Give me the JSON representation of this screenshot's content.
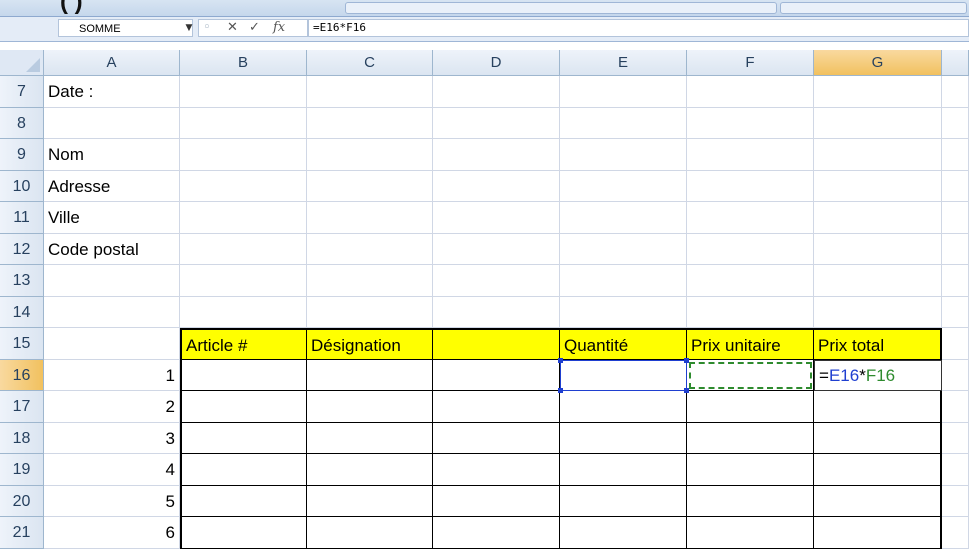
{
  "ribbon": {
    "cut_text": "(              )"
  },
  "formula_bar": {
    "name_box": "SOMME",
    "formula": "=E16*F16",
    "icons": [
      "dropdown-arrow-icon",
      "cancel-x-icon",
      "enter-check-icon",
      "function-fx-icon"
    ]
  },
  "columns": [
    "A",
    "B",
    "C",
    "D",
    "E",
    "F",
    "G"
  ],
  "selected_column": "G",
  "rows": [
    {
      "num": "7",
      "A": "Date :"
    },
    {
      "num": "8",
      "A": ""
    },
    {
      "num": "9",
      "A": "Nom"
    },
    {
      "num": "10",
      "A": "Adresse"
    },
    {
      "num": "11",
      "A": "Ville"
    },
    {
      "num": "12",
      "A": "Code postal"
    },
    {
      "num": "13",
      "A": ""
    },
    {
      "num": "14",
      "A": ""
    },
    {
      "num": "15",
      "A": ""
    },
    {
      "num": "16",
      "A": "1"
    },
    {
      "num": "17",
      "A": "2"
    },
    {
      "num": "18",
      "A": "3"
    },
    {
      "num": "19",
      "A": "4"
    },
    {
      "num": "20",
      "A": "5"
    },
    {
      "num": "21",
      "A": "6"
    }
  ],
  "selected_row": "16",
  "table_headers": {
    "B": "Article #",
    "C": "Désignation",
    "D": "",
    "E": "Quantité",
    "F": "Prix unitaire",
    "G": "Prix total"
  },
  "edit_cell": {
    "eq": "=",
    "ref1": "E16",
    "op": "*",
    "ref2": "F16"
  },
  "colors": {
    "header_fill": "#ffff00",
    "ref1": "#1f3fd0",
    "ref2": "#2e8b2e",
    "selected_header": "#f1c15f"
  }
}
